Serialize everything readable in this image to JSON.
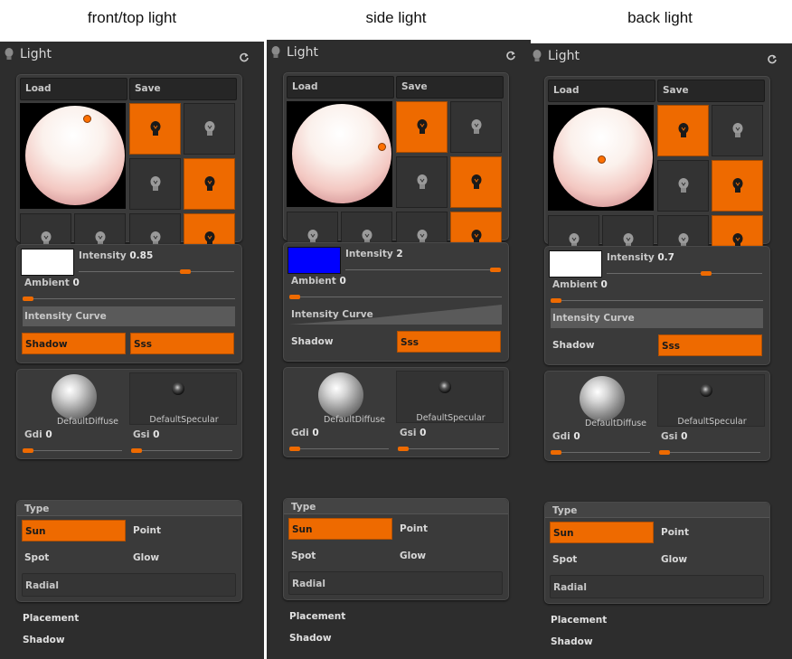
{
  "captions": [
    "front/top light",
    "side light",
    "back light"
  ],
  "header": {
    "title": "Light"
  },
  "buttons": {
    "load": "Load",
    "save": "Save"
  },
  "panels": [
    {
      "light_dot": "top-right",
      "bulbs_on": [
        true,
        false,
        false,
        true,
        false,
        false,
        false,
        true
      ],
      "color": "#ffffff",
      "intensity_label": "Intensity",
      "intensity_value": "0.85",
      "intensity_fraction": 0.7,
      "ambient_label": "Ambient",
      "ambient_value": "0",
      "curve_label": "Intensity Curve",
      "shadow_label": "Shadow",
      "shadow_on": true,
      "sss_label": "Sss",
      "sss_on": true,
      "diffuse_label": "DefaultDiffuse",
      "specular_label": "DefaultSpecular",
      "gdi_label": "Gdi",
      "gdi_value": "0",
      "gsi_label": "Gsi",
      "gsi_value": "0",
      "type_label": "Type",
      "types": [
        {
          "label": "Sun",
          "on": true
        },
        {
          "label": "Point",
          "on": false
        },
        {
          "label": "Spot",
          "on": false
        },
        {
          "label": "Glow",
          "on": false
        }
      ],
      "radial_label": "Radial",
      "placement_label": "Placement",
      "shadow_sub_label": "Shadow"
    },
    {
      "light_dot": "right",
      "bulbs_on": [
        true,
        false,
        false,
        true,
        false,
        false,
        false,
        true
      ],
      "color": "#0000ff",
      "intensity_label": "Intensity",
      "intensity_value": "2",
      "intensity_fraction": 1.0,
      "ambient_label": "Ambient",
      "ambient_value": "0",
      "curve_label": "Intensity Curve",
      "shadow_label": "Shadow",
      "shadow_on": false,
      "sss_label": "Sss",
      "sss_on": true,
      "diffuse_label": "DefaultDiffuse",
      "specular_label": "DefaultSpecular",
      "gdi_label": "Gdi",
      "gdi_value": "0",
      "gsi_label": "Gsi",
      "gsi_value": "0",
      "type_label": "Type",
      "types": [
        {
          "label": "Sun",
          "on": true
        },
        {
          "label": "Point",
          "on": false
        },
        {
          "label": "Spot",
          "on": false
        },
        {
          "label": "Glow",
          "on": false
        }
      ],
      "radial_label": "Radial",
      "placement_label": "Placement",
      "shadow_sub_label": "Shadow"
    },
    {
      "light_dot": "center",
      "bulbs_on": [
        true,
        false,
        false,
        true,
        false,
        false,
        false,
        true
      ],
      "color": "#ffffff",
      "intensity_label": "Intensity",
      "intensity_value": "0.7",
      "intensity_fraction": 0.65,
      "ambient_label": "Ambient",
      "ambient_value": "0",
      "curve_label": "Intensity Curve",
      "shadow_label": "Shadow",
      "shadow_on": false,
      "sss_label": "Sss",
      "sss_on": true,
      "diffuse_label": "DefaultDiffuse",
      "specular_label": "DefaultSpecular",
      "gdi_label": "Gdi",
      "gdi_value": "0",
      "gsi_label": "Gsi",
      "gsi_value": "0",
      "type_label": "Type",
      "types": [
        {
          "label": "Sun",
          "on": true
        },
        {
          "label": "Point",
          "on": false
        },
        {
          "label": "Spot",
          "on": false
        },
        {
          "label": "Glow",
          "on": false
        }
      ],
      "radial_label": "Radial",
      "placement_label": "Placement",
      "shadow_sub_label": "Shadow"
    }
  ],
  "colors": {
    "accent": "#ee6a00",
    "panel_bg": "#2d2d2d",
    "box_bg": "#3a3a3a"
  }
}
